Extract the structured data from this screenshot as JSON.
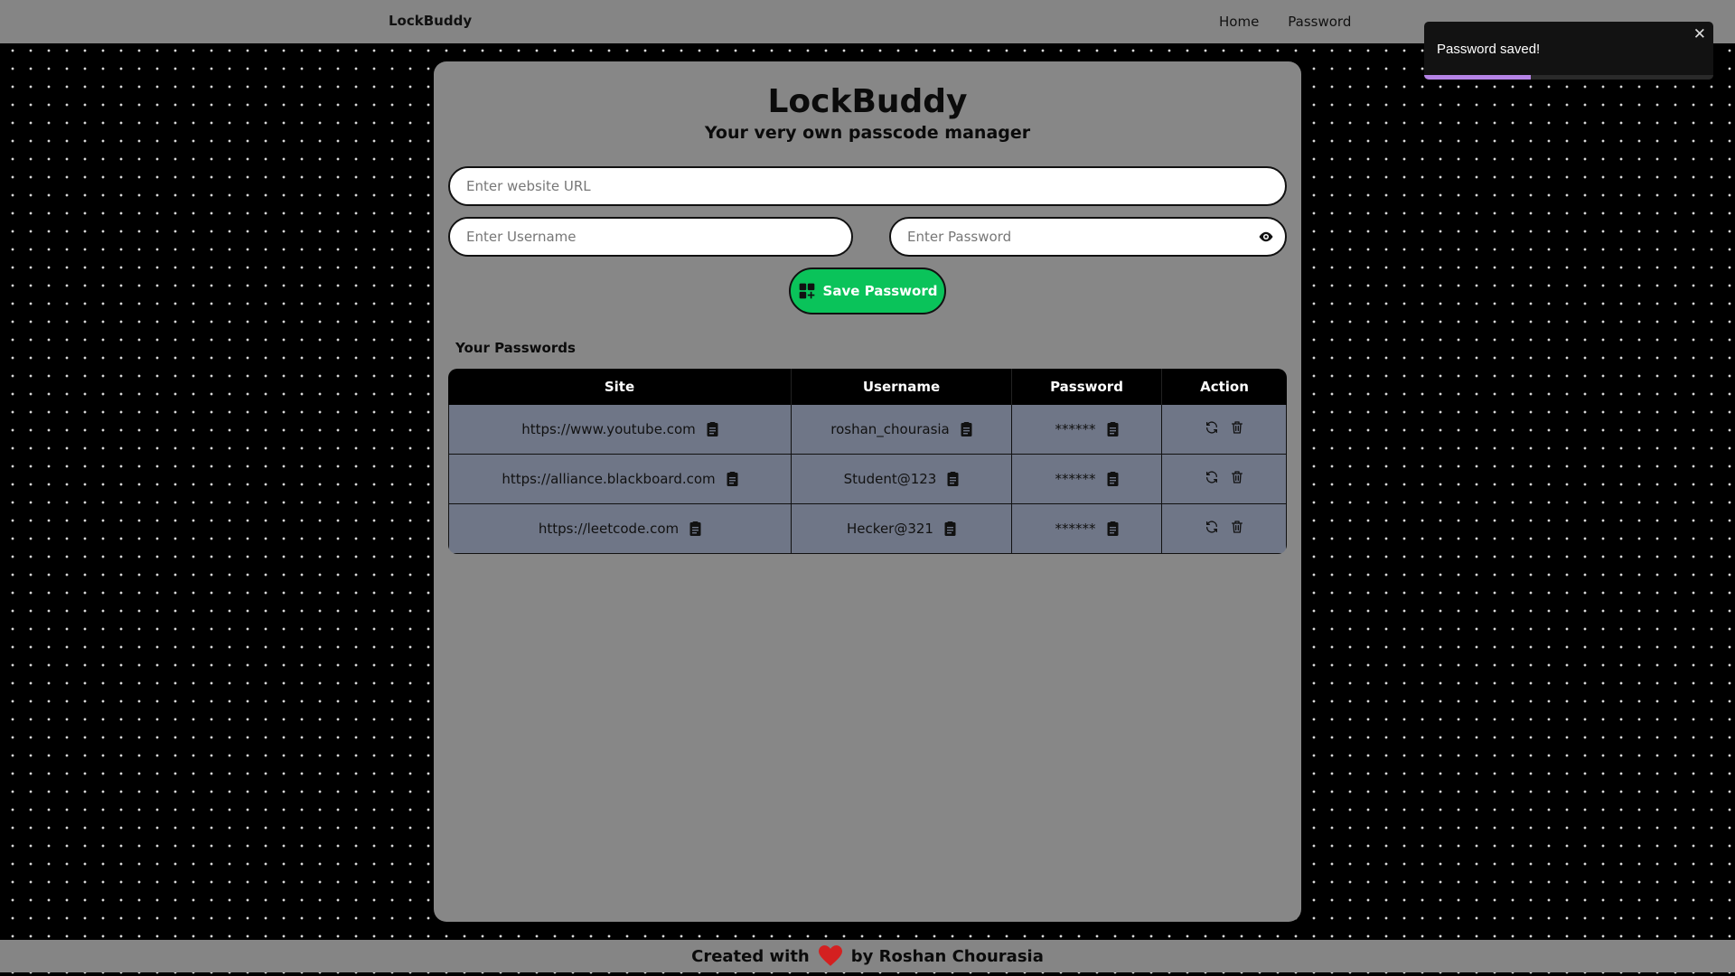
{
  "navbar": {
    "brand": "LockBuddy",
    "links": [
      "Home",
      "Password"
    ]
  },
  "toast": {
    "message": "Password saved!",
    "close_glyph": "✕",
    "progress_fraction": 0.37,
    "progress_color": "#b583e6"
  },
  "header": {
    "title": "LockBuddy",
    "subtitle": "Your very own passcode manager"
  },
  "form": {
    "url_placeholder": "Enter website URL",
    "username_placeholder": "Enter Username",
    "password_placeholder": "Enter Password",
    "save_label": "Save Password"
  },
  "table": {
    "section_title": "Your Passwords",
    "headers": [
      "Site",
      "Username",
      "Password",
      "Action"
    ],
    "rows": [
      {
        "site": "https://www.youtube.com",
        "username": "roshan_chourasia",
        "password": "******"
      },
      {
        "site": "https://alliance.blackboard.com",
        "username": "Student@123",
        "password": "******"
      },
      {
        "site": "https://leetcode.com",
        "username": "Hecker@321",
        "password": "******"
      }
    ]
  },
  "footer": {
    "prefix": "Created with",
    "suffix": "by Roshan Chourasia"
  },
  "colors": {
    "accent_green": "#0ac35a",
    "heart": "#d42020",
    "row_bg": "#6f7687"
  },
  "icons": {
    "copy": "copy-icon",
    "edit": "edit-icon",
    "delete": "delete-icon",
    "eye": "eye-icon",
    "save": "add-grid-icon",
    "heart": "heart-icon"
  }
}
